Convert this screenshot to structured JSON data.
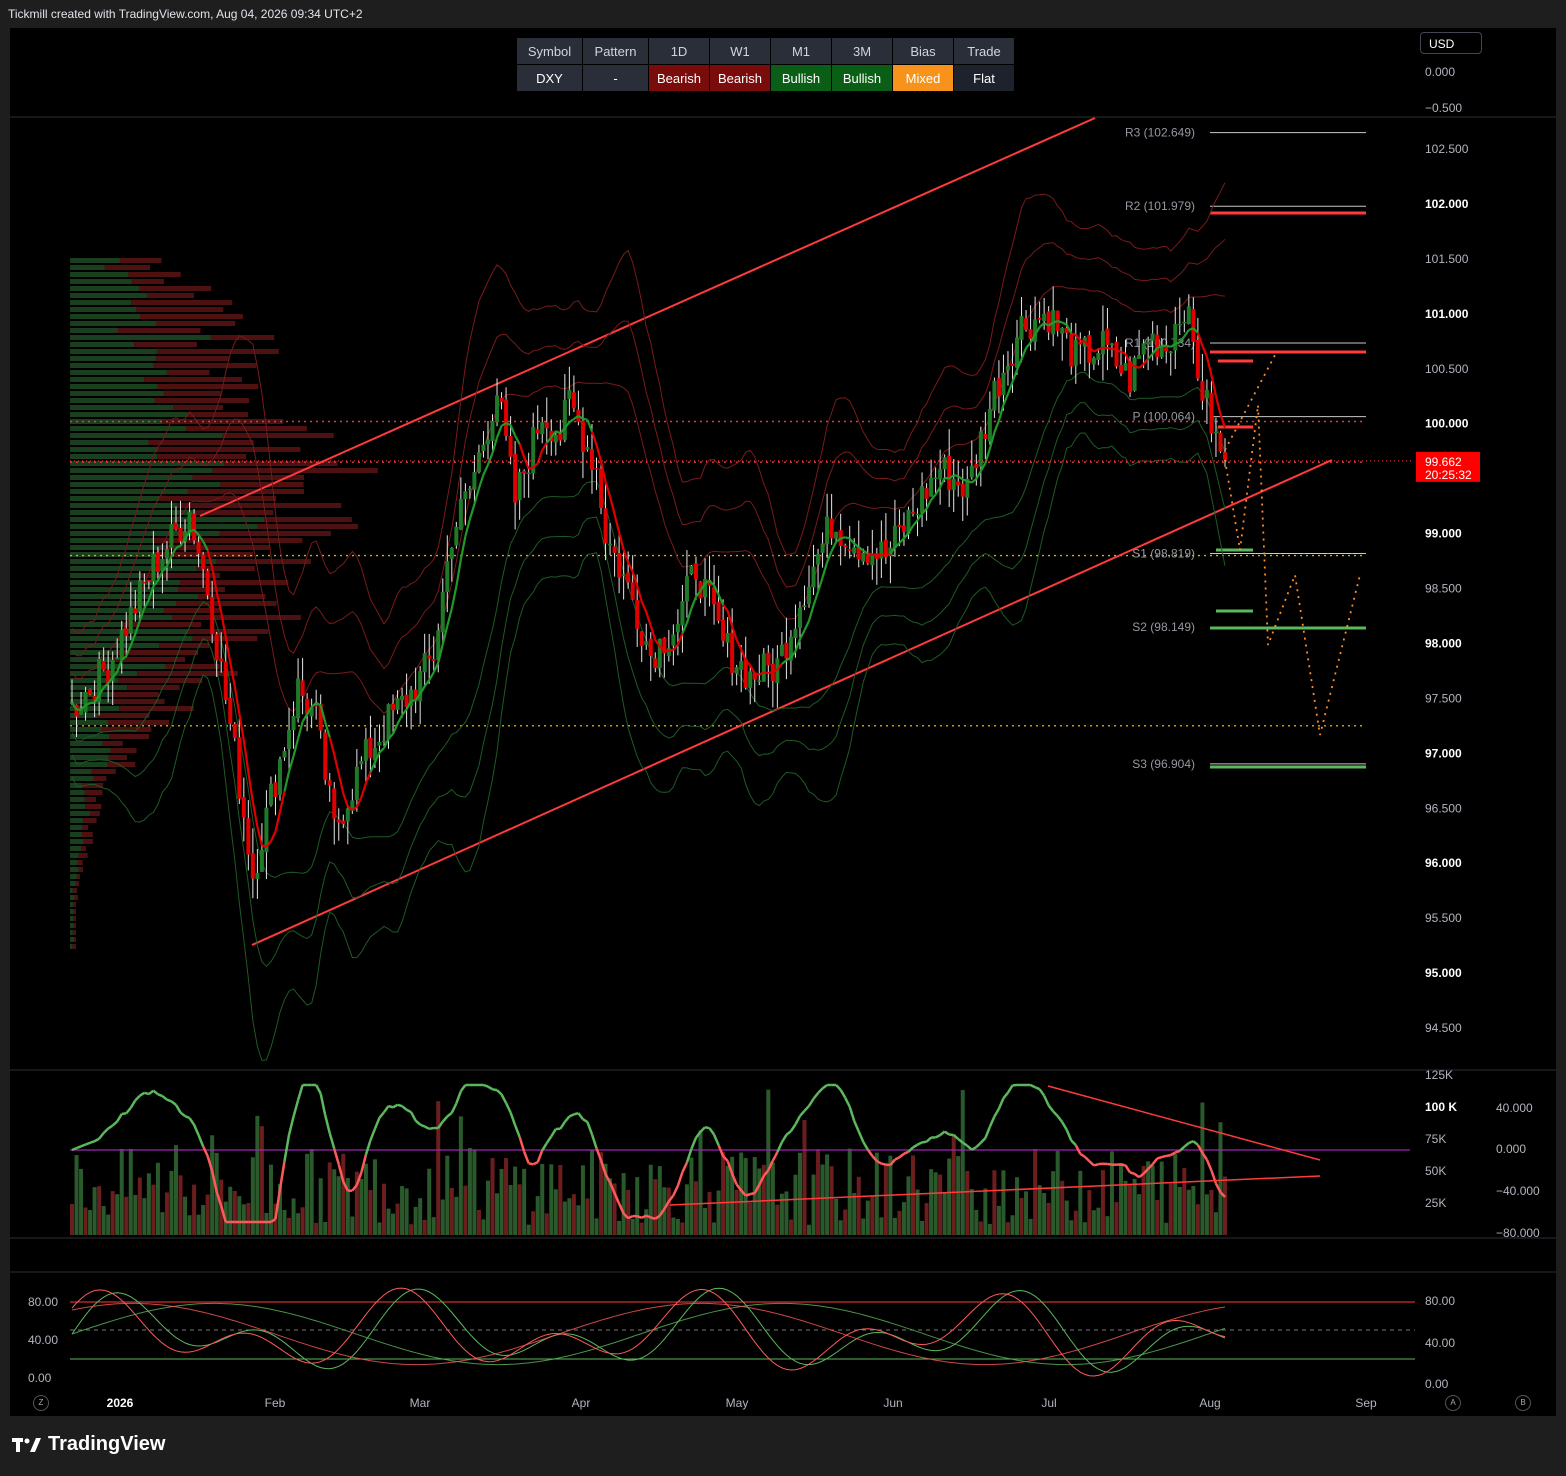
{
  "header": {
    "attribution": "Tickmill created with TradingView.com, Aug 04, 2026 09:34 UTC+2"
  },
  "brand": {
    "name": "TradingView"
  },
  "currency_button": "USD",
  "summary_table": {
    "headers": [
      "Symbol",
      "Pattern",
      "1D",
      "W1",
      "M1",
      "3M",
      "Bias",
      "Trade"
    ],
    "values": [
      "DXY",
      "-",
      "Bearish",
      "Bearish",
      "Bullish",
      "Bullish",
      "Mixed",
      "Flat"
    ],
    "colors": [
      "#2a2e39",
      "#2a2e39",
      "#7a0c0c",
      "#7a0c0c",
      "#0b5e16",
      "#0b5e16",
      "#f7931a",
      "#1e222d"
    ]
  },
  "corner_buttons": {
    "left": "Z",
    "auto": "A",
    "right": "B"
  },
  "price_tag": {
    "price": "99.662",
    "countdown": "20:25:32",
    "value": 99.662,
    "color": "#ff0000"
  },
  "colors": {
    "bull": "#1f7a27",
    "bear": "#e00000",
    "channel": "#ff3b3b",
    "pivot_green": "#5cb85c",
    "orange": "#ff8c2a"
  },
  "chart_data": [
    {
      "type": "candlestick",
      "symbol": "DXY",
      "ylim": [
        94.0,
        103.0
      ],
      "y_ticks": [
        "102.500",
        "102.000",
        "101.500",
        "101.000",
        "100.500",
        "100.000",
        "99.000",
        "98.500",
        "98.000",
        "97.500",
        "97.000",
        "96.500",
        "96.000",
        "95.500",
        "95.000",
        "94.500"
      ],
      "y_ticks_extra": [
        "0.000",
        "−0.500"
      ],
      "x_ticks": [
        "2026",
        "Feb",
        "Mar",
        "Apr",
        "May",
        "Jun",
        "Jul",
        "Aug",
        "Sep"
      ],
      "pivots": [
        {
          "label": "R3 (102.649)",
          "value": 102.649
        },
        {
          "label": "R2 (101.979)",
          "value": 101.979
        },
        {
          "label": "R1 (100.734)",
          "value": 100.734
        },
        {
          "label": "P (100.064)",
          "value": 100.064
        },
        {
          "label": "S1 (98.819)",
          "value": 98.819
        },
        {
          "label": "S2 (98.149)",
          "value": 98.149
        },
        {
          "label": "S3 (96.904)",
          "value": 96.904
        }
      ],
      "dotted_levels": [
        100.02,
        99.65,
        98.8,
        97.25
      ],
      "close_anchors": [
        [
          0,
          97.4
        ],
        [
          8,
          97.8
        ],
        [
          18,
          98.7
        ],
        [
          26,
          99.2
        ],
        [
          30,
          98.5
        ],
        [
          36,
          97.0
        ],
        [
          40,
          95.9
        ],
        [
          44,
          96.6
        ],
        [
          50,
          97.6
        ],
        [
          54,
          97.3
        ],
        [
          58,
          96.3
        ],
        [
          64,
          96.9
        ],
        [
          70,
          97.3
        ],
        [
          76,
          97.6
        ],
        [
          80,
          97.9
        ],
        [
          84,
          99.0
        ],
        [
          88,
          99.4
        ],
        [
          94,
          100.3
        ],
        [
          98,
          99.3
        ],
        [
          104,
          100.1
        ],
        [
          108,
          99.9
        ],
        [
          110,
          100.2
        ],
        [
          116,
          99.6
        ],
        [
          118,
          99.0
        ],
        [
          124,
          98.4
        ],
        [
          128,
          97.9
        ],
        [
          134,
          98.2
        ],
        [
          138,
          98.7
        ],
        [
          144,
          98.0
        ],
        [
          150,
          97.7
        ],
        [
          156,
          97.8
        ],
        [
          162,
          98.5
        ],
        [
          168,
          99.1
        ],
        [
          174,
          98.9
        ],
        [
          180,
          98.8
        ],
        [
          186,
          99.2
        ],
        [
          192,
          99.6
        ],
        [
          198,
          99.4
        ],
        [
          204,
          100.3
        ],
        [
          210,
          100.9
        ],
        [
          216,
          101.0
        ],
        [
          222,
          100.6
        ],
        [
          228,
          100.7
        ],
        [
          234,
          100.4
        ],
        [
          238,
          100.8
        ],
        [
          242,
          100.7
        ],
        [
          246,
          101.1
        ],
        [
          250,
          100.3
        ],
        [
          254,
          99.7
        ]
      ]
    },
    {
      "type": "volume_oscillator",
      "ylim_volume": [
        0,
        125000
      ],
      "volume_ticks": [
        "125K",
        "100 K",
        "75K",
        "50K",
        "25K"
      ],
      "oscillator_ticks": [
        "40.000",
        "0.000",
        "−40.000",
        "−80.000"
      ]
    },
    {
      "type": "stochastic",
      "ylim": [
        0,
        100
      ],
      "left_ticks": [
        "80.00",
        "40.00",
        "0.00"
      ],
      "right_ticks": [
        "80.00",
        "40.00",
        "0.00"
      ],
      "levels": [
        80,
        50,
        20
      ]
    }
  ]
}
